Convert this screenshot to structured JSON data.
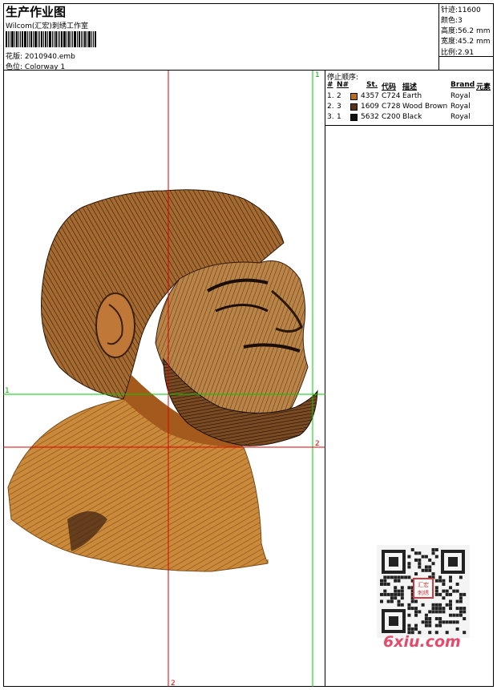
{
  "header": {
    "title": "生产作业图",
    "company": "Wilcom(汇宏)刺绣工作室",
    "design_label": "花版:",
    "design_file": "2010940.emb",
    "colorway_label": "色位:",
    "colorway": "Colorway 1"
  },
  "info": {
    "stitches_label": "针迹:",
    "stitches": "11600",
    "colors_label": "颜色:",
    "colors": "3",
    "height_label": "高度:",
    "height": "56.2 mm",
    "width_label": "宽度:",
    "width": "45.2 mm",
    "ratio_label": "比例:",
    "ratio": "2.91"
  },
  "stop_sequence": {
    "title": "停止顺序:",
    "headers": [
      "#",
      "N#",
      "St.",
      "代码",
      "描述",
      "Brand",
      "元素"
    ],
    "rows": [
      {
        "num": "1.",
        "n": "2",
        "color": "#b86a1e",
        "st": "4357",
        "code": "C724",
        "desc": "Earth",
        "brand": "Royal"
      },
      {
        "num": "2.",
        "n": "3",
        "color": "#5a3215",
        "st": "1609",
        "code": "C728",
        "desc": "Wood Brown",
        "brand": "Royal"
      },
      {
        "num": "3.",
        "n": "1",
        "color": "#111111",
        "st": "5632",
        "code": "C200",
        "desc": "Black",
        "brand": "Royal"
      }
    ]
  },
  "guides": {
    "green_v": "1",
    "green_h": "1",
    "red_h": "2",
    "red_v": "2"
  },
  "watermark": {
    "text": "6xiu.com",
    "stamp": "汇宏刺绣"
  },
  "colors": {
    "guide_red": "#e00000",
    "guide_green": "#00cc00",
    "thread_earth": "#b86a1e",
    "thread_wood": "#5a3215",
    "thread_black": "#111111"
  }
}
